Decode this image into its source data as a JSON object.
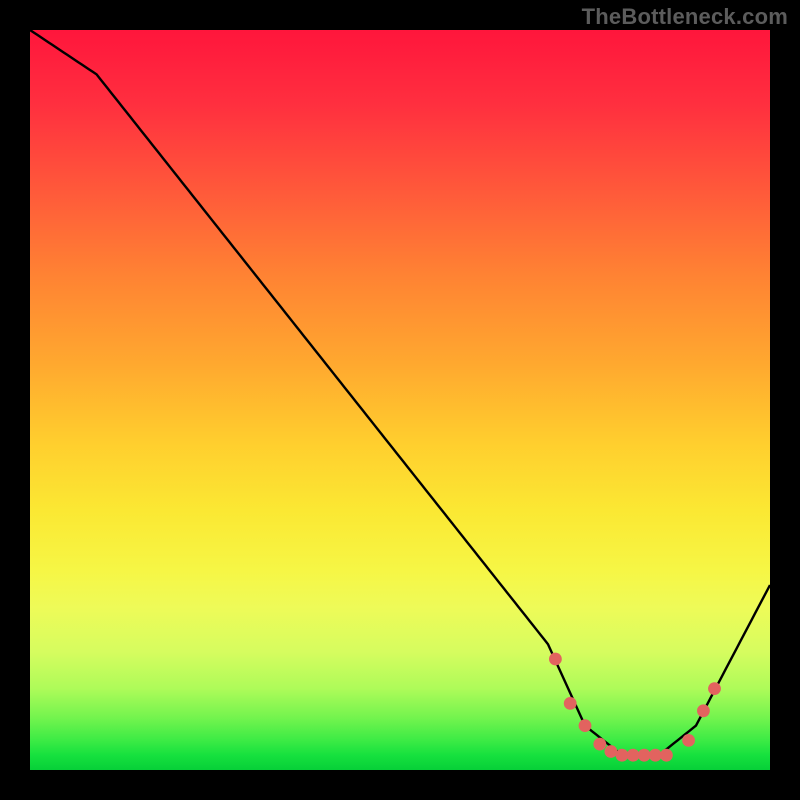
{
  "attribution": "TheBottleneck.com",
  "colors": {
    "frame": "#000000",
    "attribution_text": "#5c5c5c",
    "curve_stroke": "#000000",
    "marker_fill": "#e2635f",
    "marker_stroke": "#e2635f",
    "gradient_top": "#ff163c",
    "gradient_bottom": "#07cf38"
  },
  "chart_data": {
    "type": "line",
    "title": "",
    "xlabel": "",
    "ylabel": "",
    "xlim": [
      0,
      100
    ],
    "ylim": [
      0,
      100
    ],
    "x": [
      0,
      9,
      70,
      75,
      80,
      85,
      90,
      100
    ],
    "values": [
      100,
      94,
      17,
      6,
      2,
      2,
      6,
      25
    ],
    "marker_points": [
      {
        "x": 71,
        "y": 15
      },
      {
        "x": 73,
        "y": 9
      },
      {
        "x": 75,
        "y": 6
      },
      {
        "x": 77,
        "y": 3.5
      },
      {
        "x": 78.5,
        "y": 2.5
      },
      {
        "x": 80,
        "y": 2
      },
      {
        "x": 81.5,
        "y": 2
      },
      {
        "x": 83,
        "y": 2
      },
      {
        "x": 84.5,
        "y": 2
      },
      {
        "x": 86,
        "y": 2
      },
      {
        "x": 89,
        "y": 4
      },
      {
        "x": 91,
        "y": 8
      },
      {
        "x": 92.5,
        "y": 11
      }
    ],
    "notes": "Axes are unlabeled in the source image; y values are estimated proportions of plot height (top=100, bottom=0). Gradient background encodes value from red (high) through yellow to green (low)."
  }
}
